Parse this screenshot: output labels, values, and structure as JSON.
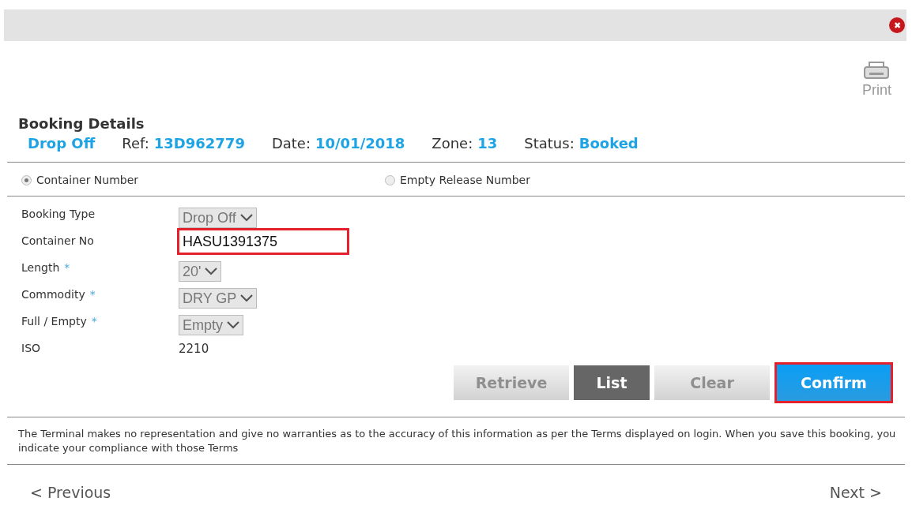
{
  "close_button": {
    "label": "✖"
  },
  "print_button": {
    "label": "Print"
  },
  "title": "Booking Details",
  "summary": [
    {
      "value": "Drop Off"
    },
    {
      "label": "Ref:",
      "value": "13D962779"
    },
    {
      "label": "Date:",
      "value": "10/01/2018"
    },
    {
      "label": "Zone:",
      "value": "13"
    },
    {
      "label": "Status:",
      "value": "Booked"
    }
  ],
  "search_by": [
    {
      "label": "Container Number",
      "selected": true
    },
    {
      "label": "Empty Release Number",
      "selected": false
    }
  ],
  "fields": [
    {
      "label": "Booking Type",
      "kind": "select",
      "value": "Drop Off"
    },
    {
      "label": "Container No",
      "kind": "input",
      "value": "HASU1391375",
      "highlighted": true
    },
    {
      "label": "Length",
      "required_mark": "*",
      "kind": "select",
      "value": "20'"
    },
    {
      "label": "Commodity",
      "required_mark": "*",
      "kind": "select",
      "value": "DRY GP"
    },
    {
      "label": "Full / Empty",
      "required_mark": "*",
      "kind": "select",
      "value": "Empty"
    },
    {
      "label": "ISO",
      "kind": "text",
      "value": "2210"
    }
  ],
  "buttons": [
    {
      "label": "Retrieve",
      "kind": "disabled",
      "highlighted": false
    },
    {
      "label": "List",
      "kind": "dark",
      "highlighted": false
    },
    {
      "label": "Clear",
      "kind": "disabled",
      "highlighted": false
    },
    {
      "label": "Confirm",
      "kind": "primary",
      "highlighted": true
    }
  ],
  "disclaimer": "The Terminal makes no representation and give no warranties as to the accuracy of this information as per the Terms displayed on login. When you save this booking, you indicate your compliance with those Terms",
  "nav": {
    "previous": "< Previous",
    "next": "Next >"
  }
}
